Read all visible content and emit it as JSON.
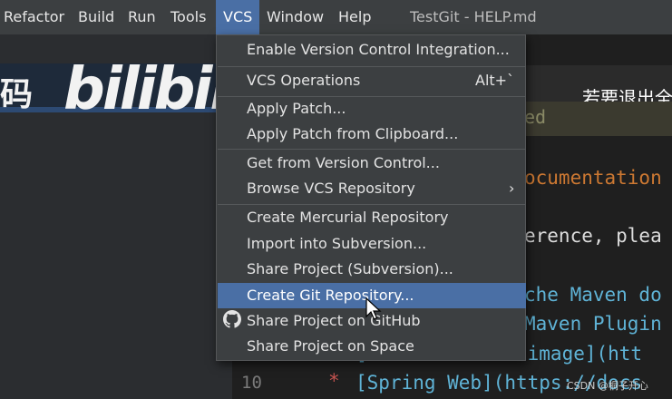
{
  "menubar": {
    "items": [
      "Refactor",
      "Build",
      "Run",
      "Tools",
      "VCS",
      "Window",
      "Help"
    ],
    "window_title": "TestGit - HELP.md"
  },
  "left_panel": {
    "cjk_text": "码"
  },
  "overlay": {
    "logo_text": "bilibili",
    "subtitle": "若要退出全",
    "watermark": "CSDN @桐子开心"
  },
  "editor": {
    "banner_text": "ed",
    "lines": [
      {
        "text": "ocumentation"
      },
      {
        "text": "erence, plea"
      },
      {
        "text": "che Maven do"
      },
      {
        "text": "Maven Plugin"
      },
      {
        "text": "[Create an OCI image](htt"
      },
      {
        "text": "[Spring Web](https://docs"
      }
    ],
    "line_number": "10",
    "star": "*"
  },
  "vcs_menu": {
    "items": [
      {
        "label": "Enable Version Control Integration..."
      },
      {
        "label": "VCS Operations",
        "shortcut": "Alt+`"
      },
      {
        "label": "Apply Patch..."
      },
      {
        "label": "Apply Patch from Clipboard..."
      },
      {
        "label": "Get from Version Control..."
      },
      {
        "label": "Browse VCS Repository",
        "submenu_arrow": "›"
      },
      {
        "label": "Create Mercurial Repository"
      },
      {
        "label": "Import into Subversion..."
      },
      {
        "label": "Share Project (Subversion)..."
      },
      {
        "label": "Create Git Repository..."
      },
      {
        "label": "Share Project on GitHub",
        "icon": "github-icon"
      },
      {
        "label": "Share Project on Space"
      }
    ],
    "highlighted_index": 9,
    "colors": {
      "highlight": "#4a6fa5",
      "menu_bg": "#3c3f41"
    }
  }
}
